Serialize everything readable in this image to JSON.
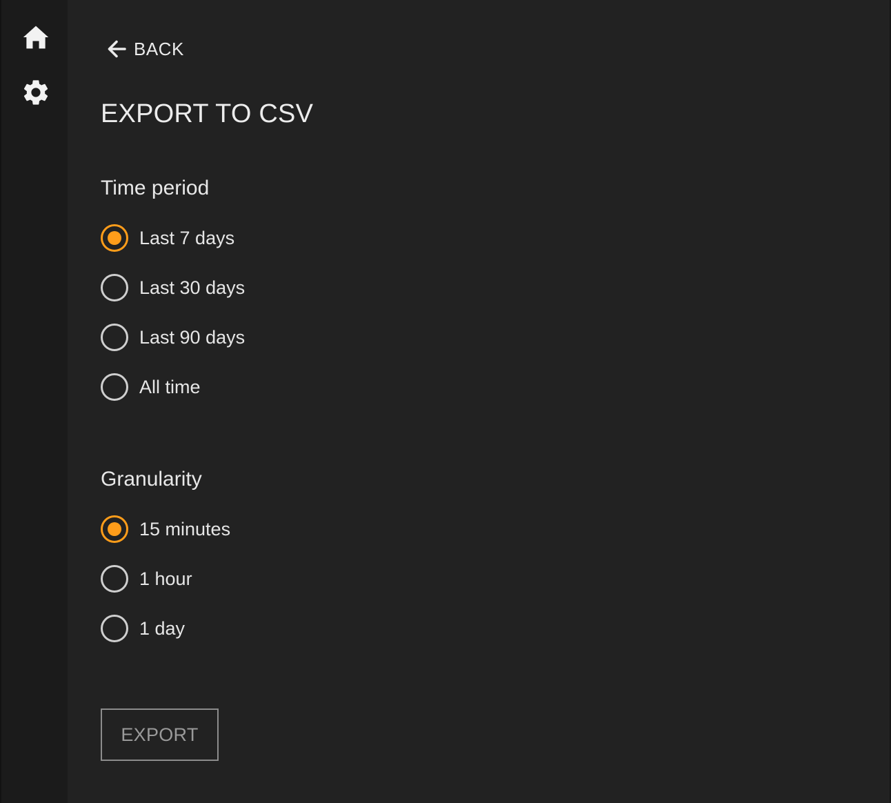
{
  "sidebar": {
    "items": [
      {
        "icon": "home-icon"
      },
      {
        "icon": "gear-icon"
      }
    ]
  },
  "nav": {
    "back_label": "BACK",
    "back_icon": "arrow-left-icon"
  },
  "page": {
    "title": "EXPORT TO CSV"
  },
  "time_period": {
    "title": "Time period",
    "selected": "Last 7 days",
    "options": [
      {
        "label": "Last 7 days",
        "checked": true
      },
      {
        "label": "Last 30 days",
        "checked": false
      },
      {
        "label": "Last 90 days",
        "checked": false
      },
      {
        "label": "All time",
        "checked": false
      }
    ]
  },
  "granularity": {
    "title": "Granularity",
    "selected": "15 minutes",
    "options": [
      {
        "label": "15 minutes",
        "checked": true
      },
      {
        "label": "1 hour",
        "checked": false
      },
      {
        "label": "1 day",
        "checked": false
      }
    ]
  },
  "actions": {
    "export_label": "EXPORT"
  },
  "colors": {
    "background": "#222222",
    "sidebar": "#1b1b1b",
    "accent": "#ff9d1a",
    "text": "#e6e6e6",
    "button_border": "#8c8c8c",
    "button_text": "#9a9a9a"
  }
}
